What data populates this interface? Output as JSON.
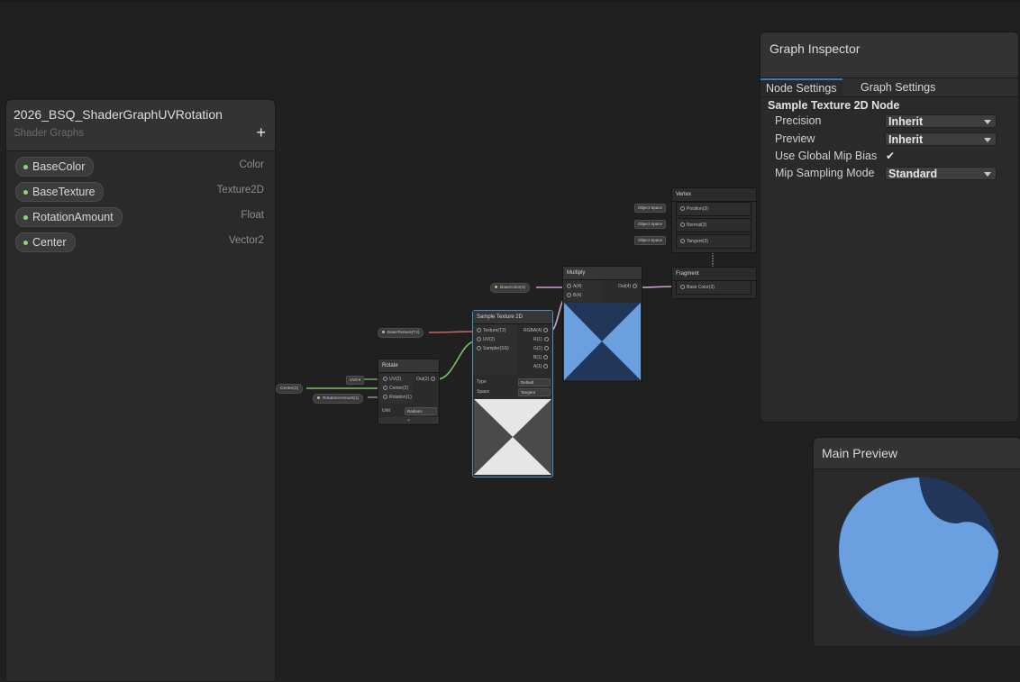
{
  "blackboard": {
    "title": "2026_BSQ_ShaderGraphUVRotation",
    "subtitle": "Shader Graphs",
    "add_label": "+",
    "properties": [
      {
        "name": "BaseColor",
        "type": "Color"
      },
      {
        "name": "BaseTexture",
        "type": "Texture2D"
      },
      {
        "name": "RotationAmount",
        "type": "Float"
      },
      {
        "name": "Center",
        "type": "Vector2"
      }
    ]
  },
  "graph": {
    "vertex": {
      "title": "Vertex",
      "ports": [
        "Position(3)",
        "Normal(3)",
        "Tangent(3)"
      ],
      "space_tags": [
        "Object Space",
        "Object Space",
        "Object Space"
      ]
    },
    "fragment": {
      "title": "Fragment",
      "ports": [
        "Base Color(3)"
      ]
    },
    "multiply": {
      "title": "Multiply",
      "inputs": [
        "A(4)",
        "B(4)"
      ],
      "output": "Out(4)"
    },
    "base_color_chip": "BaseColor(4)",
    "base_texture_chip": "BaseTexture(T2)",
    "center_chip": "Center(2)",
    "rotation_chip": "RotationAmount(1)",
    "uv_tag": "UV0",
    "sample": {
      "title": "Sample Texture 2D",
      "inputs": [
        "Texture(T2)",
        "UV(2)",
        "Sampler(SS)"
      ],
      "outputs": [
        "RGBA(4)",
        "R(1)",
        "G(1)",
        "B(1)",
        "A(1)"
      ],
      "type_label": "Type",
      "type_value": "Default",
      "space_label": "Space",
      "space_value": "Tangent"
    },
    "rotate": {
      "title": "Rotate",
      "inputs": [
        "UV(2)",
        "Center(2)",
        "Rotation(1)"
      ],
      "output": "Out(2)",
      "unit_label": "Unit",
      "unit_value": "Radians",
      "expand_icon": "chevron-down-icon"
    }
  },
  "inspector": {
    "title": "Graph Inspector",
    "tabs": [
      "Node Settings",
      "Graph Settings"
    ],
    "section": "Sample Texture 2D Node",
    "fields": [
      {
        "label": "Precision",
        "value": "Inherit"
      },
      {
        "label": "Preview",
        "value": "Inherit"
      },
      {
        "label": "Use Global Mip Bias",
        "value": "✔"
      },
      {
        "label": "Mip Sampling Mode",
        "value": "Standard"
      }
    ]
  },
  "main_preview": {
    "title": "Main Preview"
  },
  "colors": {
    "background": "#202020",
    "panel": "#2a2a2a",
    "accent_blue": "#6a9fe0",
    "dark_blue": "#22365a",
    "wire_green": "#7fbf6a",
    "wire_red": "#c0676a",
    "wire_pink": "#c9a0c8",
    "selection": "#4a90c8"
  }
}
